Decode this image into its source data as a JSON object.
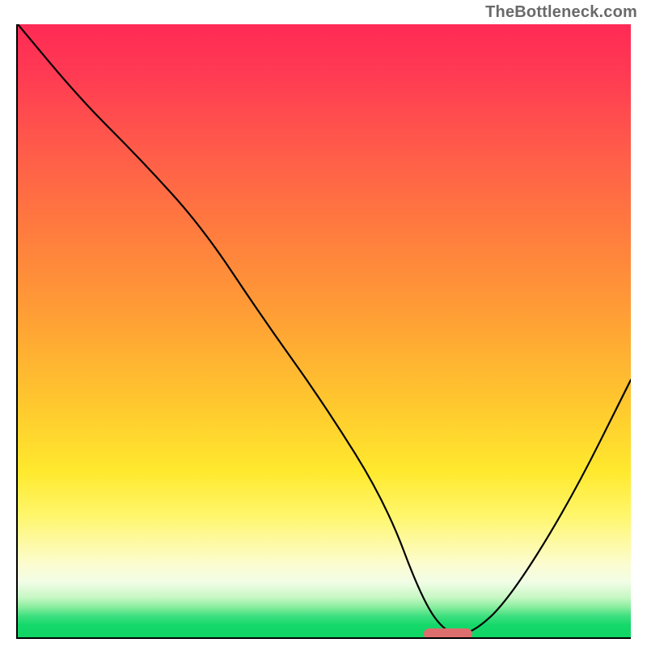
{
  "watermark": {
    "text": "TheBottleneck.com"
  },
  "chart_data": {
    "type": "line",
    "title": "",
    "xlabel": "",
    "ylabel": "",
    "xlim": [
      0,
      100
    ],
    "ylim": [
      0,
      100
    ],
    "grid": false,
    "legend": false,
    "series": [
      {
        "name": "curve",
        "x": [
          0,
          10,
          20,
          30,
          40,
          50,
          60,
          66,
          70,
          74,
          80,
          90,
          100
        ],
        "y": [
          100,
          88,
          78,
          67,
          52,
          38,
          22,
          6,
          0.5,
          0.5,
          6,
          22,
          42
        ]
      }
    ],
    "highlight": {
      "x_start": 66,
      "x_end": 74,
      "y": 0.5,
      "color": "#dd6e6e"
    },
    "background_gradient": {
      "stops": [
        {
          "pct": 0,
          "color": "#ff2a55"
        },
        {
          "pct": 20,
          "color": "#ff5a4a"
        },
        {
          "pct": 48,
          "color": "#ffa035"
        },
        {
          "pct": 73,
          "color": "#ffe92e"
        },
        {
          "pct": 88,
          "color": "#fcfccf"
        },
        {
          "pct": 96,
          "color": "#3fe07f"
        },
        {
          "pct": 100,
          "color": "#0fd564"
        }
      ]
    }
  }
}
